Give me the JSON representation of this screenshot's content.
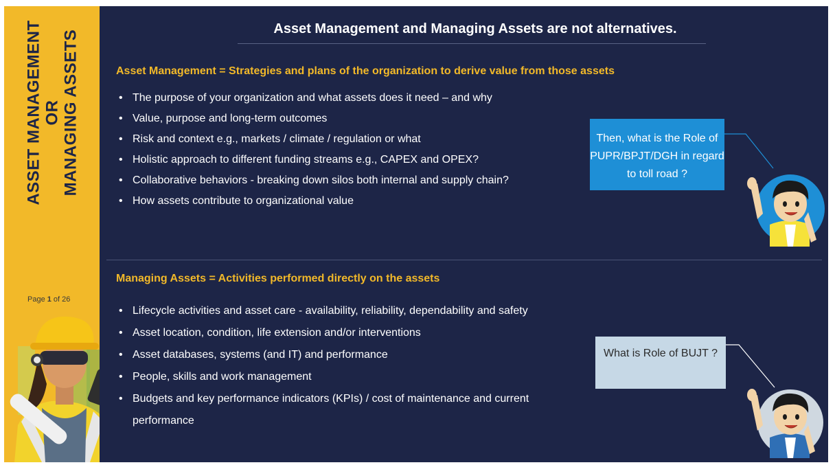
{
  "sidebar": {
    "title_line1": "ASSET MANAGEMENT",
    "title_line2": "OR",
    "title_line3": "MANAGING ASSETS",
    "page_label": "Page ",
    "page_current": "1",
    "page_of": " of 26"
  },
  "title": "Asset Management and Managing Assets are not alternatives.",
  "asset_management": {
    "heading": "Asset Management = Strategies and plans of the organization to derive value from those assets",
    "bullets": [
      "The purpose of your organization and what assets does it need – and why",
      "Value, purpose and long-term outcomes",
      "Risk and context e.g., markets / climate / regulation or what",
      "Holistic approach to different funding streams e.g., CAPEX and OPEX?",
      "Collaborative behaviors - breaking down silos both internal and supply chain?",
      "How assets contribute to organizational value"
    ]
  },
  "managing_assets": {
    "heading": "Managing Assets = Activities performed directly on the assets",
    "bullets": [
      "Lifecycle activities and asset care - availability, reliability, dependability and safety",
      "Asset location, condition, life extension and/or interventions",
      "Asset databases, systems (and IT) and performance",
      "People, skills and work management",
      "Budgets and key performance indicators (KPIs) / cost of maintenance and current performance"
    ]
  },
  "callouts": {
    "top": "Then, what is the Role of PUPR/BPJT/DGH in regard to toll road ?",
    "bottom": "What is Role of BUJT ?"
  },
  "colors": {
    "background": "#1d2547",
    "accent": "#f2b929",
    "callout_top": "#1e8fd6",
    "callout_bottom": "#c6d8e6"
  },
  "icons": [
    "mascot-icon",
    "worker-illustration"
  ]
}
